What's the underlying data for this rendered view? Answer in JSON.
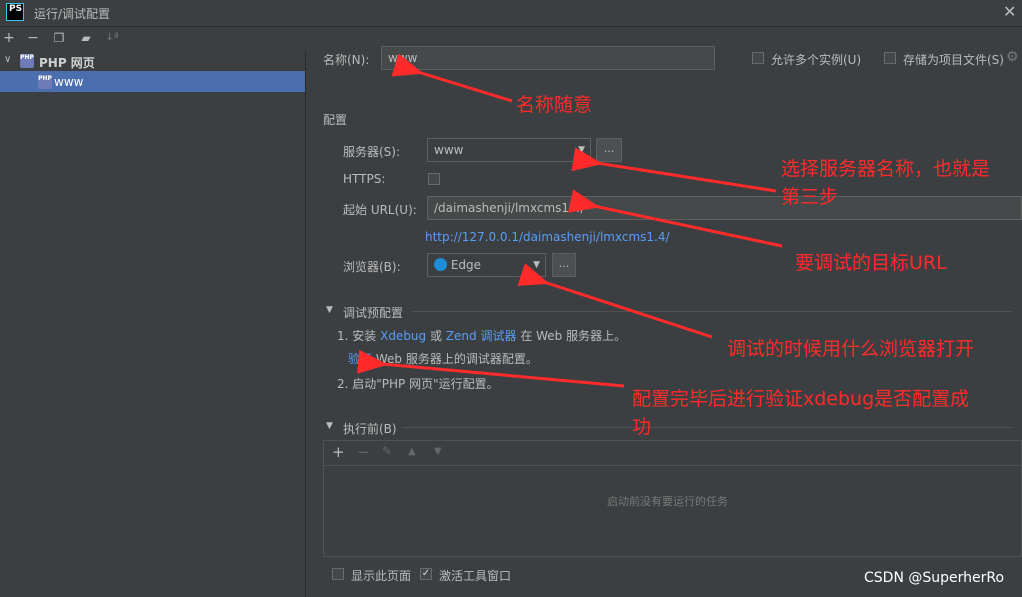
{
  "window": {
    "title": "运行/调试配置",
    "logo": "PS"
  },
  "toolbar": {
    "icons": [
      "add-icon",
      "remove-icon",
      "copy-icon",
      "folder-add-icon",
      "sort-icon"
    ]
  },
  "tree": {
    "root_label": "PHP 网页",
    "php_badge": "PHP",
    "child_label": "www"
  },
  "form": {
    "name_label": "名称(N):",
    "name_value": "www",
    "allow_multiple_label": "允许多个实例(U)",
    "store_project_label": "存储为项目文件(S)",
    "config_section": "配置",
    "server_label": "服务器(S):",
    "server_value": "www",
    "https_label": "HTTPS:",
    "url_label": "起始 URL(U):",
    "url_value": "/daimashenji/lmxcms1.4/",
    "url_full": "http://127.0.0.1/daimashenji/lmxcms1.4/",
    "browser_label": "浏览器(B):",
    "browser_value": "Edge",
    "dots": "...",
    "debug_section": "调试预配置",
    "step1_prefix": "1. 安装",
    "step1_xdebug": "Xdebug",
    "step1_or": "或",
    "step1_zend": "Zend 调试器",
    "step1_suffix": "在 Web 服务器上。",
    "verify_link": "验证",
    "verify_suffix": "Web 服务器上的调试器配置。",
    "step2": "2. 启动\"PHP 网页\"运行配置。",
    "before_section": "执行前(B)",
    "before_empty": "启动前没有要运行的任务",
    "show_page_label": "显示此页面",
    "activate_tool_label": "激活工具窗口"
  },
  "annotations": {
    "a1": "名称随意",
    "a2_line1": "选择服务器名称，也就是",
    "a2_line2": "第三步",
    "a3": "要调试的目标URL",
    "a4": "调试的时候用什么浏览器打开",
    "a5_line1": "配置完毕后进行验证xdebug是否配置成",
    "a5_line2": "功"
  },
  "watermark": "CSDN @SuperherRo",
  "colors": {
    "background": "#3c3f41",
    "selection": "#4b6eaf",
    "link": "#589df6",
    "annotation": "#ff2a2a"
  }
}
